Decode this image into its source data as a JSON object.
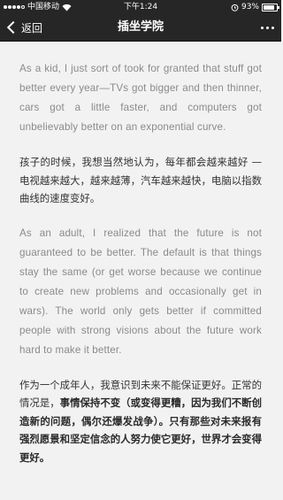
{
  "status_bar": {
    "carrier": "中国移动",
    "time": "下午1:24",
    "battery": "93%"
  },
  "nav": {
    "back_label": "返回",
    "title": "插坐学院"
  },
  "article": {
    "p1_en": "As a kid, I just sort of took for granted that stuff got better every year—TVs got bigger and then thinner, cars got a little faster, and computers got unbelievably better on an exponential curve.",
    "p1_zh": "孩子的时候，我想当然地认为，每年都会越来越好 — 电视越来越大，越来越薄，汽车越来越快，电脑以指数曲线的速度变好。",
    "p2_en": "As an adult, I realized that the future is not guaranteed to be better. The default is that things stay the same (or get worse because we continue to create new problems and occasionally get in wars). The world only gets better if committed people with strong visions about the future work hard to make it better.",
    "p2_zh_a": "作为一个成年人，我意识到未来不能保证更好。正常的情况是，",
    "p2_zh_b": "事情保持不变（或变得更糟，因为我们不断创造新的问题，偶尔还爆发战争）。只有那些对未来报有强烈愿景和坚定信念的人努力使它更好，世界才会变得更好。"
  },
  "icons": [
    "chevron-left-icon",
    "more-dots-icon",
    "wifi-icon",
    "alarm-icon",
    "battery-icon"
  ]
}
